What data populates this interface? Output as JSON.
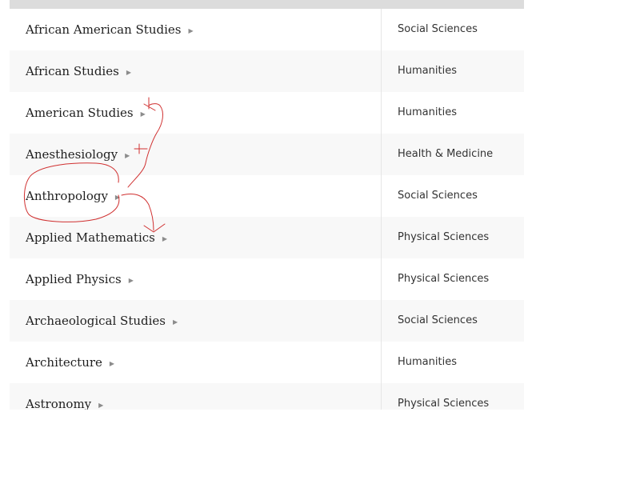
{
  "programs": [
    {
      "name": "African American Studies",
      "category": "Social Sciences"
    },
    {
      "name": "African Studies",
      "category": "Humanities"
    },
    {
      "name": "American Studies",
      "category": "Humanities"
    },
    {
      "name": "Anesthesiology",
      "category": "Health & Medicine"
    },
    {
      "name": "Anthropology",
      "category": "Social Sciences"
    },
    {
      "name": "Applied Mathematics",
      "category": "Physical Sciences"
    },
    {
      "name": "Applied Physics",
      "category": "Physical Sciences"
    },
    {
      "name": "Archaeological Studies",
      "category": "Social Sciences"
    },
    {
      "name": "Architecture",
      "category": "Humanities"
    },
    {
      "name": "Astronomy",
      "category": "Physical Sciences"
    }
  ],
  "icons": {
    "row_arrow": "triangle-right-icon"
  },
  "colors": {
    "header_bar": "#dcdcdc",
    "row_alt": "#f8f8f8",
    "annotation_ink": "#d03030"
  }
}
